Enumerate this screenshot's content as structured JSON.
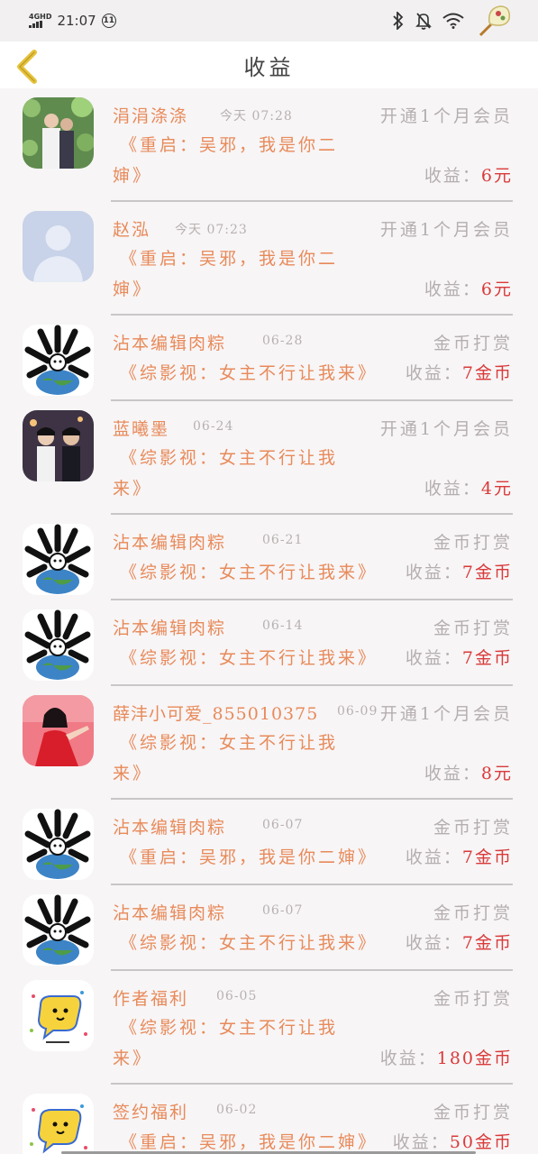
{
  "status_bar": {
    "network": "4GHD",
    "time": "21:07",
    "circle_glyph": "11"
  },
  "header": {
    "title": "收益"
  },
  "rows": [
    {
      "name": "涓涓涤涤",
      "date": "今天 07:28",
      "type": "开通1个月会员",
      "book_line1": "《重启：吴邪，我是你二",
      "book_line2": "婶》",
      "earn_label": "收益：",
      "earn_value": "6元",
      "avatar": "photo-couple"
    },
    {
      "name": "赵泓",
      "date": "今天 07:23",
      "type": "开通1个月会员",
      "book_line1": "《重启：吴邪，我是你二",
      "book_line2": "婶》",
      "earn_label": "收益：",
      "earn_value": "6元",
      "avatar": "default-user"
    },
    {
      "name": "沾本编辑肉粽",
      "date": "06-28",
      "type": "金币打赏",
      "book_line1": "《综影视：女主不行让我来》",
      "book_line2": "",
      "earn_label": "收益：",
      "earn_value": "7金币",
      "avatar": "cartoon-earth"
    },
    {
      "name": "蓝曦墨",
      "date": "06-24",
      "type": "开通1个月会员",
      "book_line1": "《综影视：女主不行让我",
      "book_line2": "来》",
      "earn_label": "收益：",
      "earn_value": "4元",
      "avatar": "photo-two-men"
    },
    {
      "name": "沾本编辑肉粽",
      "date": "06-21",
      "type": "金币打赏",
      "book_line1": "《综影视：女主不行让我来》",
      "book_line2": "",
      "earn_label": "收益：",
      "earn_value": "7金币",
      "avatar": "cartoon-earth"
    },
    {
      "name": "沾本编辑肉粽",
      "date": "06-14",
      "type": "金币打赏",
      "book_line1": "《综影视：女主不行让我来》",
      "book_line2": "",
      "earn_label": "收益：",
      "earn_value": "7金币",
      "avatar": "cartoon-earth"
    },
    {
      "name": "薛沣小可爱_855010375",
      "date": "06-09",
      "type": "开通1个月会员",
      "book_line1": "《综影视：女主不行让我",
      "book_line2": "来》",
      "earn_label": "收益：",
      "earn_value": "8元",
      "avatar": "photo-red-dress"
    },
    {
      "name": "沾本编辑肉粽",
      "date": "06-07",
      "type": "金币打赏",
      "book_line1": "《重启：吴邪，我是你二婶》",
      "book_line2": "",
      "earn_label": "收益：",
      "earn_value": "7金币",
      "avatar": "cartoon-earth"
    },
    {
      "name": "沾本编辑肉粽",
      "date": "06-07",
      "type": "金币打赏",
      "book_line1": "《综影视：女主不行让我来》",
      "book_line2": "",
      "earn_label": "收益：",
      "earn_value": "7金币",
      "avatar": "cartoon-earth"
    },
    {
      "name": "作者福利",
      "date": "06-05",
      "type": "金币打赏",
      "book_line1": "《综影视：女主不行让我",
      "book_line2": "来》",
      "earn_label": "收益：",
      "earn_value": "180金币",
      "avatar": "chat-bubble"
    },
    {
      "name": "签约福利",
      "date": "06-02",
      "type": "金币打赏",
      "book_line1": "《重启：吴邪，我是你二婶》",
      "book_line2": "",
      "earn_label": "收益：",
      "earn_value": "50金币",
      "avatar": "chat-bubble"
    }
  ],
  "colors": {
    "accent_orange": "#e88a5a",
    "earn_red": "#d93a3a",
    "muted_gray": "#b5aeb0",
    "back_yellow": "#e6c23a"
  },
  "icons": {
    "back": "chevron-left-icon",
    "bluetooth": "bluetooth-icon",
    "mute": "bell-off-icon",
    "wifi": "wifi-icon",
    "fan": "fan-icon"
  }
}
